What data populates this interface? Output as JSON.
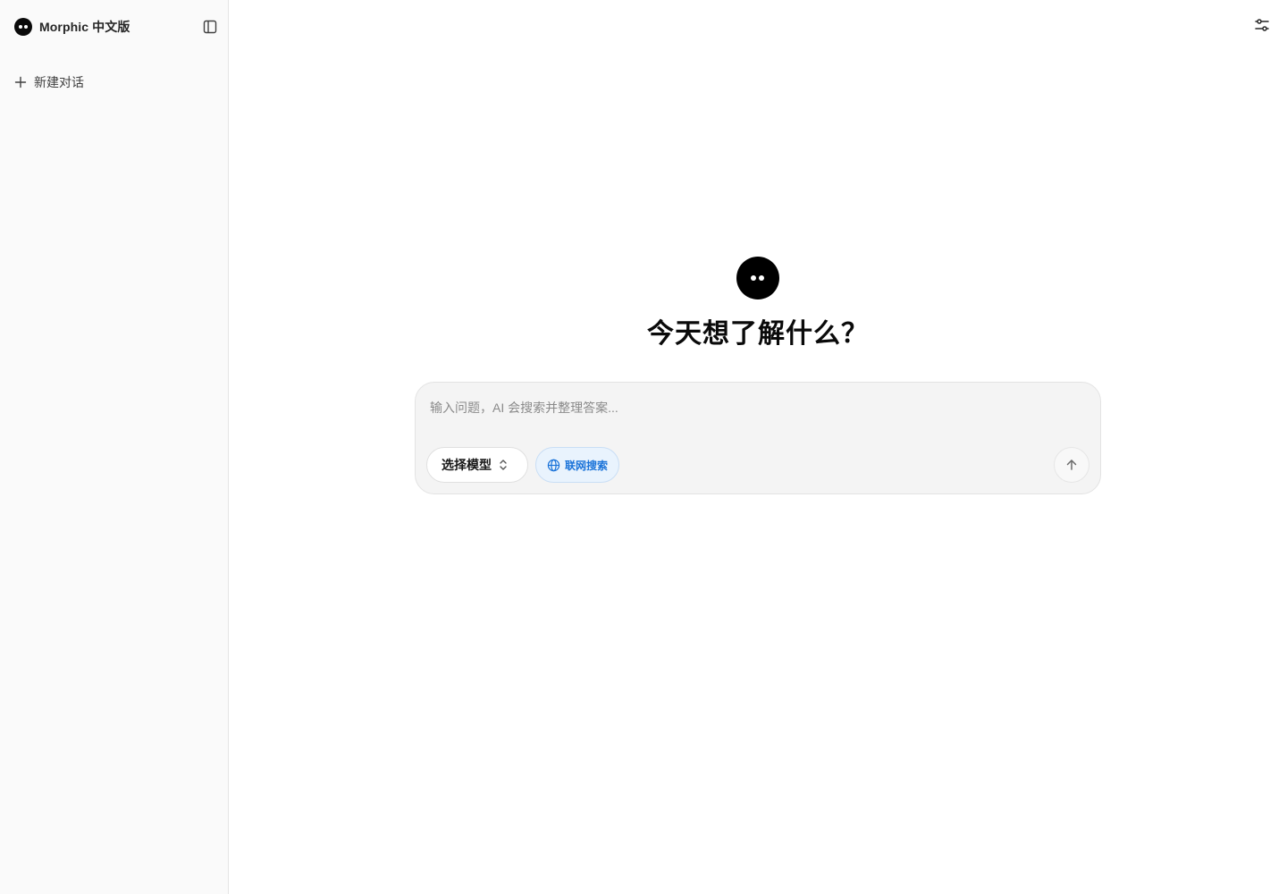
{
  "sidebar": {
    "brand": {
      "name": "Morphic 中文版",
      "logo_icon": "morphic-logo-icon"
    },
    "toggle_icon": "sidebar-panel-icon",
    "new_chat": {
      "label": "新建对话",
      "icon": "plus-icon"
    }
  },
  "header": {
    "settings_icon": "sliders-icon"
  },
  "hero": {
    "logo_icon": "morphic-logo-icon",
    "title": "今天想了解什么？"
  },
  "composer": {
    "placeholder": "输入问题，AI 会搜索并整理答案...",
    "value": "",
    "model_select": {
      "label": "选择模型",
      "icon": "chevrons-up-down-icon"
    },
    "web_search": {
      "label": "联网搜索",
      "icon": "globe-icon",
      "active": true
    },
    "send_icon": "arrow-up-icon"
  },
  "colors": {
    "sidebar_bg": "#fafafa",
    "composer_bg": "#f4f4f4",
    "accent": "#1a73d9",
    "accent_bg": "#e9f3fd",
    "text": "#171717"
  }
}
